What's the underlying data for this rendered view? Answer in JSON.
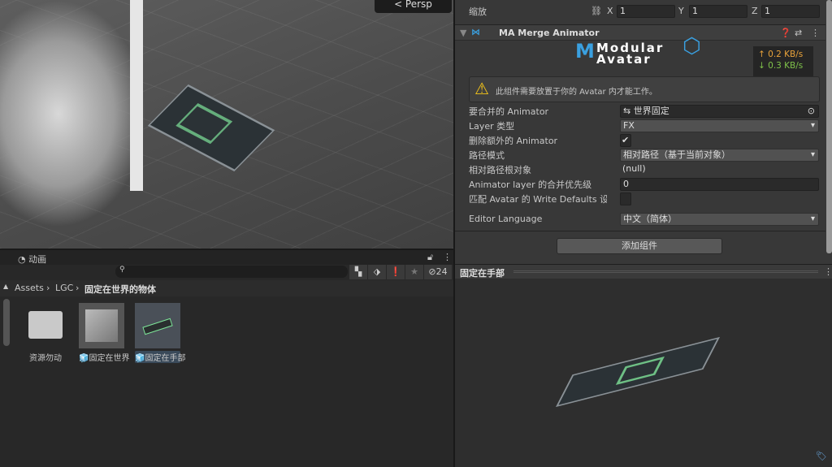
{
  "scene": {
    "camera_label": "< Persp"
  },
  "inspector": {
    "scale_label": "缩放",
    "scale": {
      "x_label": "X",
      "x": "1",
      "y_label": "Y",
      "y": "1",
      "z_label": "Z",
      "z": "1"
    },
    "component_title": "MA Merge Animator",
    "logo_text": [
      "Modular",
      "Avatar"
    ],
    "net_up": "↑ 0.2 KB/s",
    "net_down": "↓ 0.3 KB/s",
    "warning": "此组件需要放置于你的 Avatar 内才能工作。",
    "fields": [
      {
        "label": "要合并的 Animator",
        "value": "世界固定"
      },
      {
        "label": "Layer 类型",
        "value": "FX"
      },
      {
        "label": "删除额外的 Animator",
        "value": "✔"
      },
      {
        "label": "路径模式",
        "value": "相对路径（基于当前对象）"
      },
      {
        "label": "相对路径根对象",
        "value": "(null)"
      },
      {
        "label": "Animator layer 的合并优先级",
        "value": "0"
      },
      {
        "label": "匹配 Avatar 的 Write Defaults 设",
        "value": ""
      },
      {
        "label": "Editor Language",
        "value": "中文（简体）"
      }
    ],
    "add_component": "添加组件"
  },
  "preview": {
    "title": "固定在手部"
  },
  "project": {
    "tab": "动画",
    "hidden_count": "24",
    "breadcrumb": [
      "Assets",
      "LGC",
      "固定在世界的物体"
    ],
    "assets": [
      {
        "name": "资源勿动"
      },
      {
        "name": "固定在世界"
      },
      {
        "name": "固定在手部"
      }
    ]
  },
  "colors": {
    "up": "#e8a23a",
    "down": "#7fc24a",
    "accent": "#3aa0e0"
  }
}
